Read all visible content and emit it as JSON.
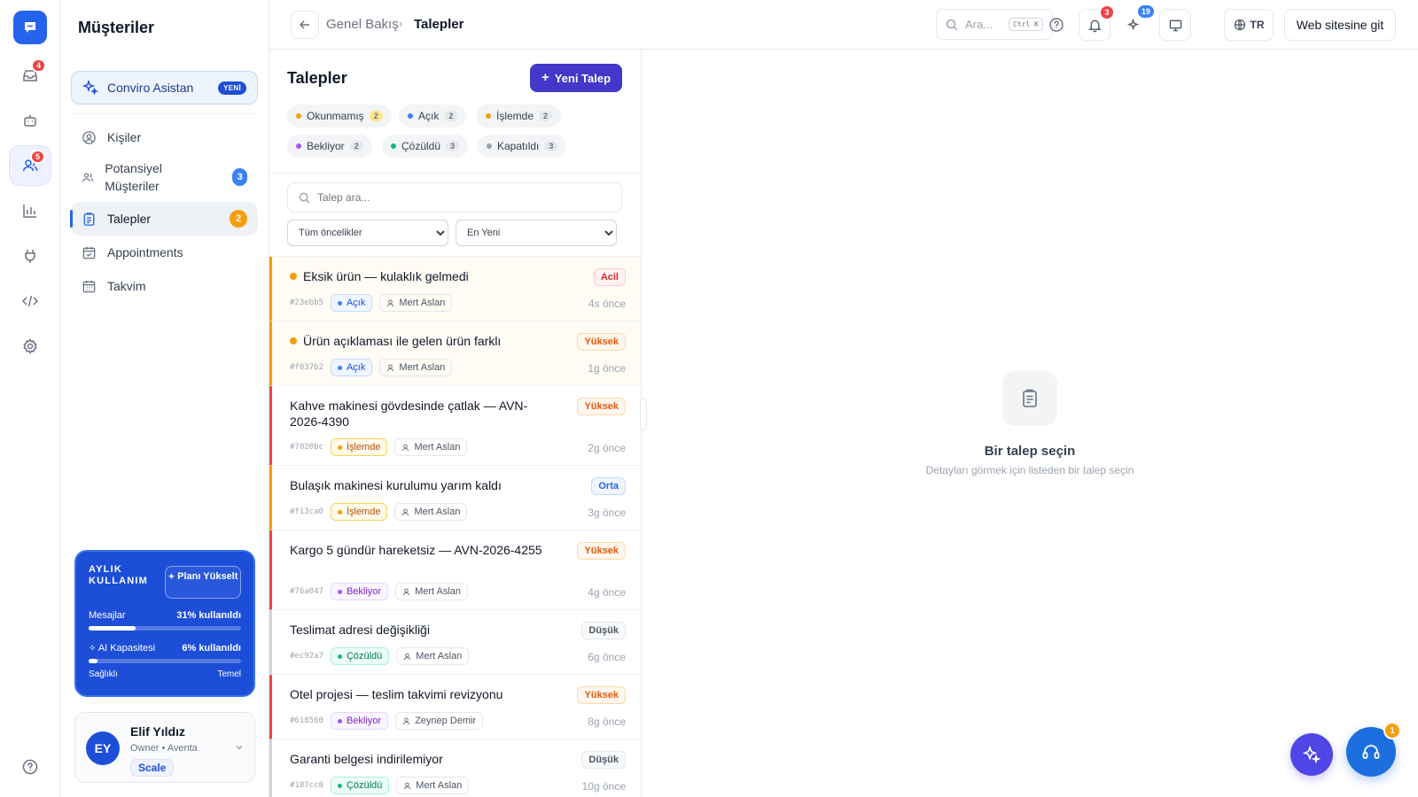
{
  "rail": {
    "inbox_badge": "4",
    "contacts_badge": "5"
  },
  "sidebar": {
    "title": "Müşteriler",
    "assistant": {
      "label": "Conviro Asistan",
      "badge": "YENİ"
    },
    "items": [
      {
        "label": "Kişiler"
      },
      {
        "label": "Potansiyel Müşteriler",
        "count": "3",
        "count_color": "#3b82f6"
      },
      {
        "label": "Talepler",
        "count": "2",
        "count_color": "#f59e0b"
      },
      {
        "label": "Appointments"
      },
      {
        "label": "Takvim"
      }
    ],
    "usage": {
      "title": "AYLIK KULLANIM",
      "upgrade_label": "Planı Yükselt",
      "messages_label": "Mesajlar",
      "messages_value": "31% kullanıldı",
      "messages_pct": 31,
      "ai_label": "AI Kapasitesi",
      "ai_value": "6% kullanıldı",
      "ai_pct": 6,
      "health_label": "Sağlıklı",
      "tier_label": "Temel"
    },
    "user": {
      "initials": "EY",
      "name": "Elif Yıldız",
      "role": "Owner • Aventa",
      "plan": "Scale"
    }
  },
  "topbar": {
    "breadcrumb_parent": "Genel Bakış",
    "breadcrumb_current": "Talepler",
    "search_placeholder": "Ara...",
    "search_shortcut": "Ctrl K",
    "notifications_badge": "3",
    "updates_badge": "19",
    "language": "TR",
    "website_button": "Web sitesine git"
  },
  "list": {
    "title": "Talepler",
    "new_button": "Yeni Talep",
    "filters": [
      {
        "label": "Okunmamış",
        "count": "2",
        "color": "#f59e0b",
        "count_bg": "#fde68a"
      },
      {
        "label": "Açık",
        "count": "2",
        "color": "#3b82f6",
        "count_bg": "#e5e7eb"
      },
      {
        "label": "İşlemde",
        "count": "2",
        "color": "#f59e0b",
        "count_bg": "#e5e7eb"
      },
      {
        "label": "Bekliyor",
        "count": "2",
        "color": "#a855f7",
        "count_bg": "#e5e7eb"
      },
      {
        "label": "Çözüldü",
        "count": "3",
        "color": "#10b981",
        "count_bg": "#e5e7eb"
      },
      {
        "label": "Kapatıldı",
        "count": "3",
        "color": "#9ca3af",
        "count_bg": "#e5e7eb"
      }
    ],
    "search_placeholder": "Talep ara...",
    "priority_select": {
      "selected": "Tüm öncelikler"
    },
    "sort_select": {
      "selected": "En Yeni"
    },
    "tickets": [
      {
        "title": "Eksik ürün — kulaklık gelmedi",
        "unread": true,
        "priority": "Acil",
        "id": "#23ebb5",
        "status": "Açık",
        "assignee": "Mert Aslan",
        "time": "4s önce",
        "accent": "#f59e0b"
      },
      {
        "title": "Ürün açıklaması ile gelen ürün farklı",
        "unread": true,
        "priority": "Yüksek",
        "id": "#f037b2",
        "status": "Açık",
        "assignee": "Mert Aslan",
        "time": "1g önce",
        "accent": "#f59e0b"
      },
      {
        "title": "Kahve makinesi gövdesinde çatlak — AVN-2026-4390",
        "unread": false,
        "priority": "Yüksek",
        "id": "#7020bc",
        "status": "İşlemde",
        "assignee": "Mert Aslan",
        "time": "2g önce",
        "accent": "#ef4444"
      },
      {
        "title": "Bulaşık makinesi kurulumu yarım kaldı",
        "unread": false,
        "priority": "Orta",
        "id": "#f13ca0",
        "status": "İşlemde",
        "assignee": "Mert Aslan",
        "time": "3g önce",
        "accent": "#f59e0b"
      },
      {
        "title": "Kargo 5 gündür hareketsiz — AVN-2026-4255",
        "unread": false,
        "priority": "Yüksek",
        "id": "#76a047",
        "status": "Bekliyor",
        "assignee": "Mert Aslan",
        "time": "4g önce",
        "accent": "#ef4444"
      },
      {
        "title": "Teslimat adresi değişikliği",
        "unread": false,
        "priority": "Düşük",
        "id": "#ec92a7",
        "status": "Çözüldü",
        "assignee": "Mert Aslan",
        "time": "6g önce",
        "accent": "#d1d5db"
      },
      {
        "title": "Otel projesi — teslim takvimi revizyonu",
        "unread": false,
        "priority": "Yüksek",
        "id": "#618560",
        "status": "Bekliyor",
        "assignee": "Zeynep Demir",
        "time": "8g önce",
        "accent": "#ef4444"
      },
      {
        "title": "Garanti belgesi indirilemiyor",
        "unread": false,
        "priority": "Düşük",
        "id": "#187cc8",
        "status": "Çözüldü",
        "assignee": "Mert Aslan",
        "time": "10g önce",
        "accent": "#d1d5db"
      }
    ]
  },
  "priority_styles": {
    "Acil": {
      "color": "#dc2626",
      "bg": "#fef2f2",
      "border": "#fecaca"
    },
    "Yüksek": {
      "color": "#ea580c",
      "bg": "#fff7ed",
      "border": "#fed7aa"
    },
    "Orta": {
      "color": "#2563eb",
      "bg": "#eff6ff",
      "border": "#bfdbfe"
    },
    "Düşük": {
      "color": "#4b5563",
      "bg": "#f9fafb",
      "border": "#e5e7eb"
    }
  },
  "status_styles": {
    "Açık": {
      "color": "#1d4ed8",
      "bg": "#eff6ff",
      "border": "#bfdbfe",
      "dot": "#3b82f6"
    },
    "İşlemde": {
      "color": "#b45309",
      "bg": "#fffbeb",
      "border": "#fcd34d",
      "dot": "#f59e0b"
    },
    "Bekliyor": {
      "color": "#7e22ce",
      "bg": "#faf5ff",
      "border": "#e9d5ff",
      "dot": "#a855f7"
    },
    "Çözüldü": {
      "color": "#047857",
      "bg": "#ecfdf5",
      "border": "#a7f3d0",
      "dot": "#10b981"
    }
  },
  "detail": {
    "empty_title": "Bir talep seçin",
    "empty_subtitle": "Detayları görmek için listeden bir talep seçin"
  },
  "fab": {
    "support_badge": "1"
  },
  "icons": {
    "logo": "chat-logo-icon",
    "rail": [
      "inbox-icon",
      "bot-icon",
      "users-icon",
      "chart-icon",
      "plug-icon",
      "code-icon",
      "settings-icon",
      "help-icon"
    ]
  }
}
